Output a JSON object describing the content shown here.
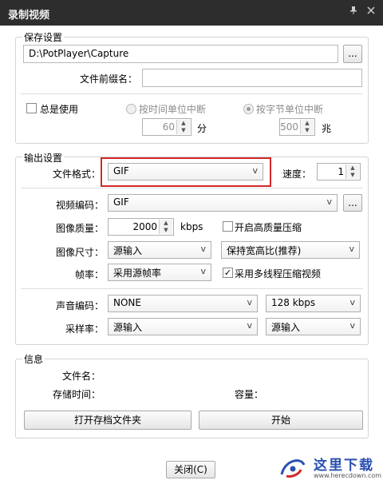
{
  "window": {
    "title": "录制视频",
    "pin_icon": "pin-icon",
    "close_icon": "close-icon"
  },
  "save": {
    "group_title": "保存设置",
    "path_value": "D:\\PotPlayer\\Capture",
    "browse_label": "...",
    "prefix_label": "文件前缀名：",
    "prefix_value": "",
    "always_use_label": "总是使用",
    "always_use_checked": false,
    "time_unit_label": "按时间单位中断",
    "time_value": "60",
    "time_unit": "分",
    "byte_unit_label": "按字节单位中断",
    "byte_value": "500",
    "byte_unit": "兆"
  },
  "output": {
    "group_title": "输出设置",
    "format_label": "文件格式：",
    "format_value": "GIF",
    "speed_label": "速度：",
    "speed_value": "1",
    "video_codec_label": "视频编码：",
    "video_codec_value": "GIF",
    "video_codec_more": "...",
    "quality_label": "图像质量：",
    "quality_value": "2000",
    "quality_unit": "kbps",
    "hq_label": "开启高质量压缩",
    "hq_checked": false,
    "size_label": "图像尺寸：",
    "size_value": "源输入",
    "aspect_value": "保持宽高比(推荐)",
    "fps_label": "帧率：",
    "fps_value": "采用源帧率",
    "multithread_label": "采用多线程压缩视频",
    "multithread_checked": true,
    "audio_codec_label": "声音编码：",
    "audio_codec_value": "NONE",
    "audio_bitrate_value": "128 kbps",
    "samplerate_label": "采样率：",
    "samplerate_value": "源输入",
    "channels_value": "源输入"
  },
  "info": {
    "group_title": "信息",
    "filename_label": "文件名：",
    "duration_label": "存储时间：",
    "size_label": "容量：",
    "open_folder_label": "打开存档文件夹",
    "start_label": "开始"
  },
  "footer": {
    "close_label": "关闭(C)"
  },
  "watermark": {
    "text": "这里下载",
    "url_text": "www.herecdown.com"
  }
}
